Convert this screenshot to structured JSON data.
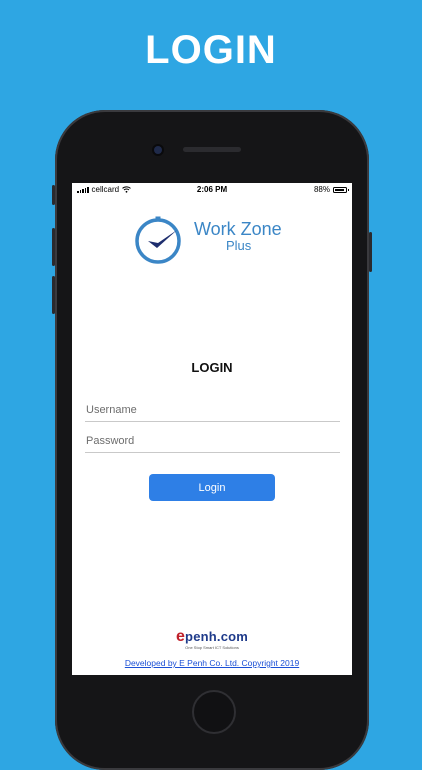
{
  "promo": {
    "title": "LOGIN"
  },
  "status_bar": {
    "carrier": "cellcard",
    "time": "2:06 PM",
    "battery_percent": "88%",
    "battery_level": 0.88,
    "wifi_icon": "wifi-icon",
    "signal_icon": "signal-icon"
  },
  "app": {
    "logo_line1": "Work Zone",
    "logo_line2": "Plus",
    "logo_icon": "clock-icon",
    "accent_color": "#3b86c6"
  },
  "login_form": {
    "heading": "LOGIN",
    "username_placeholder": "Username",
    "username_value": "",
    "password_placeholder": "Password",
    "password_value": "",
    "login_label": "Login",
    "button_color": "#2e7fe6"
  },
  "footer": {
    "brand_e": "e",
    "brand_rest": "penh",
    "brand_domain": ".com",
    "tagline": "One Stop Smart ICT Solutions",
    "developer_link": "Developed by E Penh Co. Ltd. Copyright 2019"
  },
  "colors": {
    "background": "#2ea6e3"
  }
}
